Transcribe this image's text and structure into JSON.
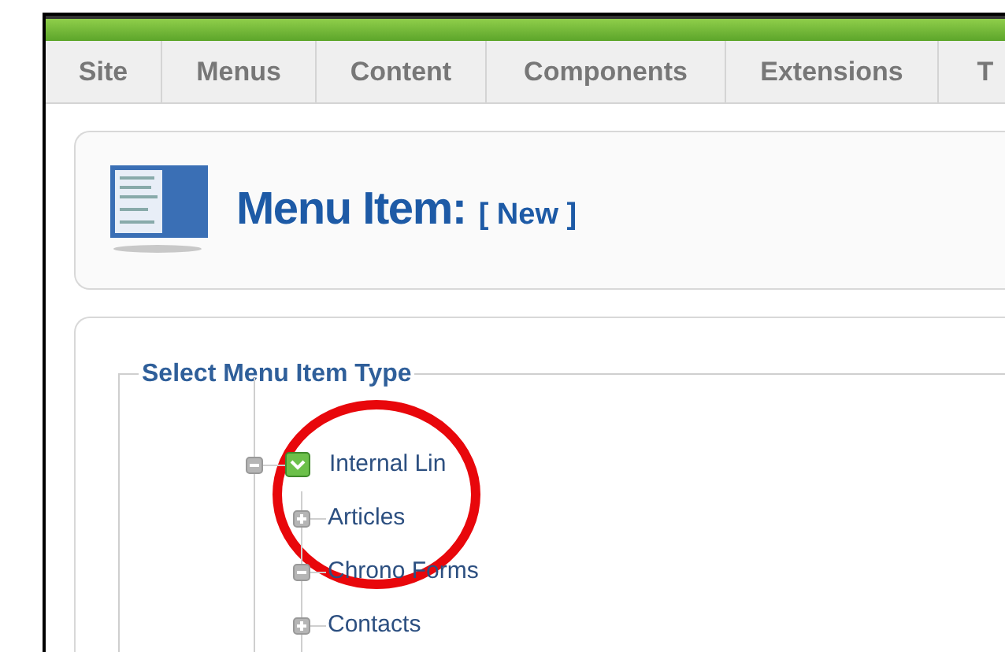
{
  "menu_tabs": [
    {
      "label": "Site"
    },
    {
      "label": "Menus"
    },
    {
      "label": "Content"
    },
    {
      "label": "Components"
    },
    {
      "label": "Extensions"
    },
    {
      "label": "T"
    }
  ],
  "header": {
    "title": "Menu Item:",
    "subtitle": "[ New ]"
  },
  "panel": {
    "legend": "Select Menu Item Type",
    "tree": [
      {
        "label": "Internal Lin",
        "expanded": true,
        "children": [
          {
            "label": "Articles",
            "expanded": false
          },
          {
            "label": "Chrono Forms",
            "expanded": true
          },
          {
            "label": "Contacts",
            "expanded": false
          }
        ]
      }
    ]
  }
}
